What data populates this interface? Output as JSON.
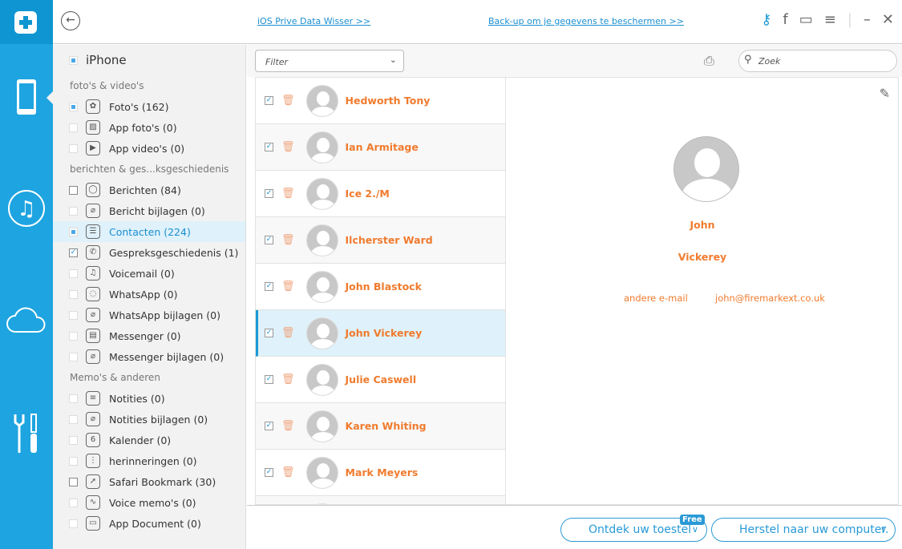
{
  "rail": {
    "icons": [
      "app-logo-icon",
      "phone-icon",
      "music-icon",
      "cloud-icon",
      "tools-icon"
    ]
  },
  "top": {
    "link1": "iOS Prive Data Wisser >>",
    "link2": "Back-up om je gegevens te beschermen >>"
  },
  "sidebar": {
    "device": "iPhone",
    "categories": [
      {
        "label": "foto's & video's",
        "items": [
          {
            "label": "Foto's (162)",
            "state": "partial",
            "icon": "✿"
          },
          {
            "label": "App foto's (0)",
            "state": "disabled",
            "icon": "▨"
          },
          {
            "label": "App video's (0)",
            "state": "disabled",
            "icon": "▶"
          }
        ]
      },
      {
        "label": "berichten & ges...ksgeschiedenis",
        "items": [
          {
            "label": "Berichten (84)",
            "state": "unchecked",
            "icon": "◯"
          },
          {
            "label": "Bericht bijlagen (0)",
            "state": "disabled",
            "icon": "⌀"
          },
          {
            "label": "Contacten (224)",
            "state": "partial",
            "icon": "☰",
            "selected": true
          },
          {
            "label": "Gespreksgeschiedenis (1)",
            "state": "checked",
            "icon": "✆"
          },
          {
            "label": "Voicemail (0)",
            "state": "disabled",
            "icon": "♫"
          },
          {
            "label": "WhatsApp (0)",
            "state": "disabled",
            "icon": "◌"
          },
          {
            "label": "WhatsApp bijlagen (0)",
            "state": "disabled",
            "icon": "⌀"
          },
          {
            "label": "Messenger (0)",
            "state": "disabled",
            "icon": "▤"
          },
          {
            "label": "Messenger bijlagen (0)",
            "state": "disabled",
            "icon": "⌀"
          }
        ]
      },
      {
        "label": "Memo's & anderen",
        "items": [
          {
            "label": "Notities (0)",
            "state": "disabled",
            "icon": "≡"
          },
          {
            "label": "Notities bijlagen (0)",
            "state": "disabled",
            "icon": "⌀"
          },
          {
            "label": "Kalender (0)",
            "state": "disabled",
            "icon": "6"
          },
          {
            "label": "herinneringen (0)",
            "state": "disabled",
            "icon": "⋮"
          },
          {
            "label": "Safari Bookmark (30)",
            "state": "unchecked",
            "icon": "➚"
          },
          {
            "label": "Voice memo's (0)",
            "state": "disabled",
            "icon": "∿"
          },
          {
            "label": "App Document (0)",
            "state": "disabled",
            "icon": "▭"
          }
        ]
      }
    ]
  },
  "toolbar": {
    "filter": "Filter",
    "search_placeholder": "Zoek"
  },
  "contacts": [
    "Hedworth Tony",
    "Ian Armitage",
    "Ice 2./M",
    "Ilcherster Ward",
    "John Blastock",
    "John Vickerey",
    "Julie Caswell",
    "Karen Whiting",
    "Mark Meyers",
    ""
  ],
  "selected_contact": 5,
  "detail": {
    "first": "John",
    "last": "Vickerey",
    "email_label": "andere e-mail",
    "email": "john@firemarkext.co.uk"
  },
  "bottom": {
    "discover": "Ontdek uw toestel",
    "free": "Free",
    "restore": "Herstel naar uw computer."
  },
  "colors": {
    "accent": "#1ea4e0",
    "name": "#f07b2e"
  }
}
